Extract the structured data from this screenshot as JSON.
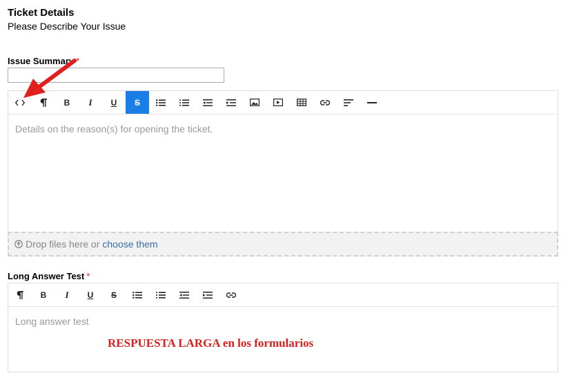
{
  "section": {
    "title": "Ticket Details",
    "subtitle": "Please Describe Your Issue"
  },
  "issue_summary": {
    "label": "Issue Summary",
    "required_mark": "*",
    "value": ""
  },
  "editor1": {
    "toolbar": [
      {
        "name": "code-view-icon",
        "glyph": "<>"
      },
      {
        "name": "paragraph-icon",
        "glyph": "¶"
      },
      {
        "name": "bold-button",
        "glyph": "B"
      },
      {
        "name": "italic-button",
        "glyph": "I"
      },
      {
        "name": "underline-button",
        "glyph": "U"
      },
      {
        "name": "strikethrough-button",
        "glyph": "S",
        "active": true
      },
      {
        "name": "bullet-list-icon"
      },
      {
        "name": "numbered-list-icon"
      },
      {
        "name": "outdent-icon"
      },
      {
        "name": "indent-icon"
      },
      {
        "name": "image-icon"
      },
      {
        "name": "video-icon"
      },
      {
        "name": "table-icon"
      },
      {
        "name": "link-icon"
      },
      {
        "name": "align-left-icon"
      },
      {
        "name": "horizontal-rule-icon"
      }
    ],
    "placeholder": "Details on the reason(s) for opening the ticket.",
    "dropzone_text": "Drop files here or",
    "dropzone_link": "choose them"
  },
  "long_answer": {
    "label": "Long Answer Test",
    "required_mark": "*",
    "placeholder": "Long answer test"
  },
  "annotation": {
    "text": "RESPUESTA LARGA en los formularios",
    "arrow_color": "#e02020"
  }
}
